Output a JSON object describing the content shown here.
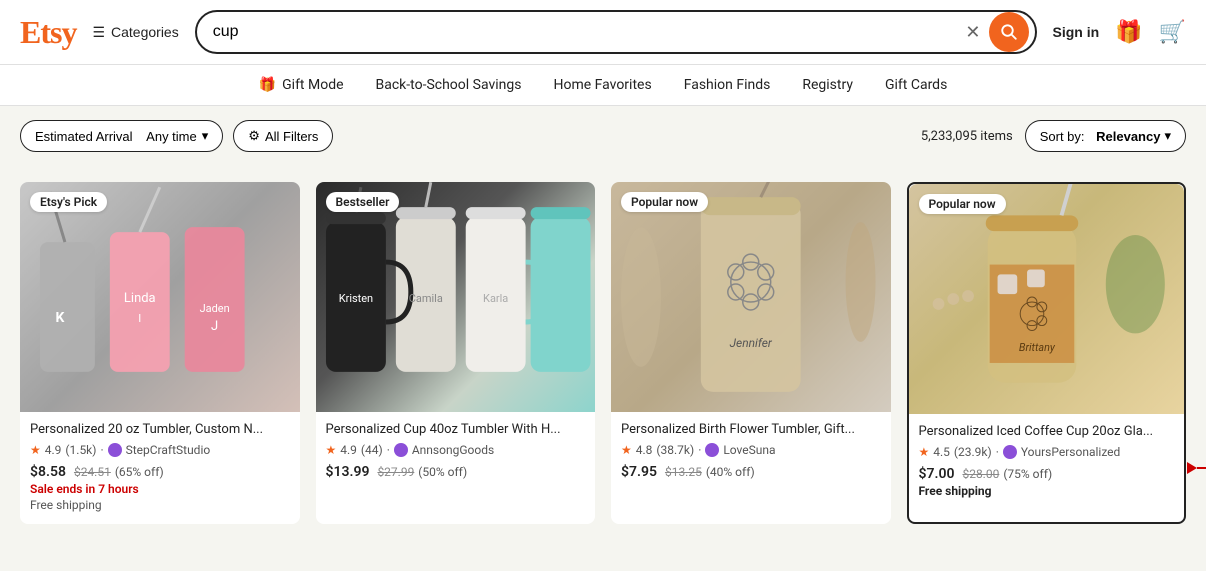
{
  "header": {
    "logo": "Etsy",
    "categories_label": "Categories",
    "search_value": "cup",
    "search_clear_label": "✕",
    "search_button_label": "🔍",
    "sign_in_label": "Sign in",
    "gift_icon": "🎁",
    "cart_icon": "🛒"
  },
  "nav": {
    "items": [
      {
        "label": "Gift Mode",
        "icon": "🎁"
      },
      {
        "label": "Back-to-School Savings"
      },
      {
        "label": "Home Favorites"
      },
      {
        "label": "Fashion Finds"
      },
      {
        "label": "Registry"
      },
      {
        "label": "Gift Cards"
      }
    ]
  },
  "filters": {
    "arrival_label": "Estimated Arrival",
    "arrival_value": "Any time",
    "all_filters_label": "All Filters",
    "items_count": "5,233,095 items",
    "sort_label": "Sort by:",
    "sort_value": "Relevancy"
  },
  "products": [
    {
      "badge": "Etsy's Pick",
      "title": "Personalized 20 oz Tumbler, Custom N...",
      "rating": "4.9",
      "reviews": "(1.5k)",
      "shop": "StepCraftStudio",
      "price": "$8.58",
      "original_price": "$24.51",
      "discount": "(65% off)",
      "sale_text": "Sale ends in 7 hours",
      "shipping": "Free shipping"
    },
    {
      "badge": "Bestseller",
      "title": "Personalized Cup 40oz Tumbler With H...",
      "rating": "4.9",
      "reviews": "(44)",
      "shop": "AnnsongGoods",
      "price": "$13.99",
      "original_price": "$27.99",
      "discount": "(50% off)",
      "sale_text": "",
      "shipping": ""
    },
    {
      "badge": "Popular now",
      "title": "Personalized Birth Flower Tumbler, Gift...",
      "rating": "4.8",
      "reviews": "(38.7k)",
      "shop": "LoveSuna",
      "price": "$7.95",
      "original_price": "$13.25",
      "discount": "(40% off)",
      "sale_text": "",
      "shipping": ""
    },
    {
      "badge": "Popular now",
      "title": "Personalized Iced Coffee Cup 20oz Gla...",
      "rating": "4.5",
      "reviews": "(23.9k)",
      "shop": "YoursPersonalized",
      "price": "$7.00",
      "original_price": "$28.00",
      "discount": "(75% off)",
      "sale_text": "",
      "shipping": "Free shipping",
      "highlighted": true,
      "has_arrow": true
    }
  ]
}
